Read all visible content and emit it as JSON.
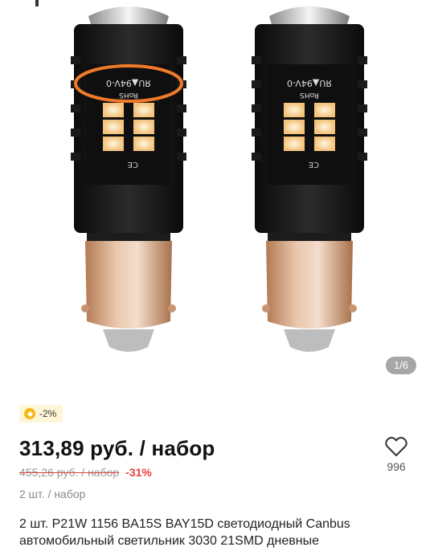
{
  "gallery": {
    "counter": "1/6",
    "bulb_marking": "RoHS",
    "bulb_code": "ЯU▲94V-0"
  },
  "promo": {
    "badge": "-2%"
  },
  "product": {
    "price": "313,89 руб. / набор",
    "old_price": "455,26 руб. / набор",
    "discount": "-31%",
    "unit": "2 шт. / набор",
    "favorites_count": "996",
    "title": "2 шт. P21W 1156 BA15S BAY15D светодиодный Canbus автомобильный светильник 3030 21SMD дневные"
  },
  "colors": {
    "accent_red": "#e8413a",
    "highlight_orange": "#f07a2a",
    "badge_bg": "#fff6d8",
    "coin_yellow": "#f5b817"
  }
}
